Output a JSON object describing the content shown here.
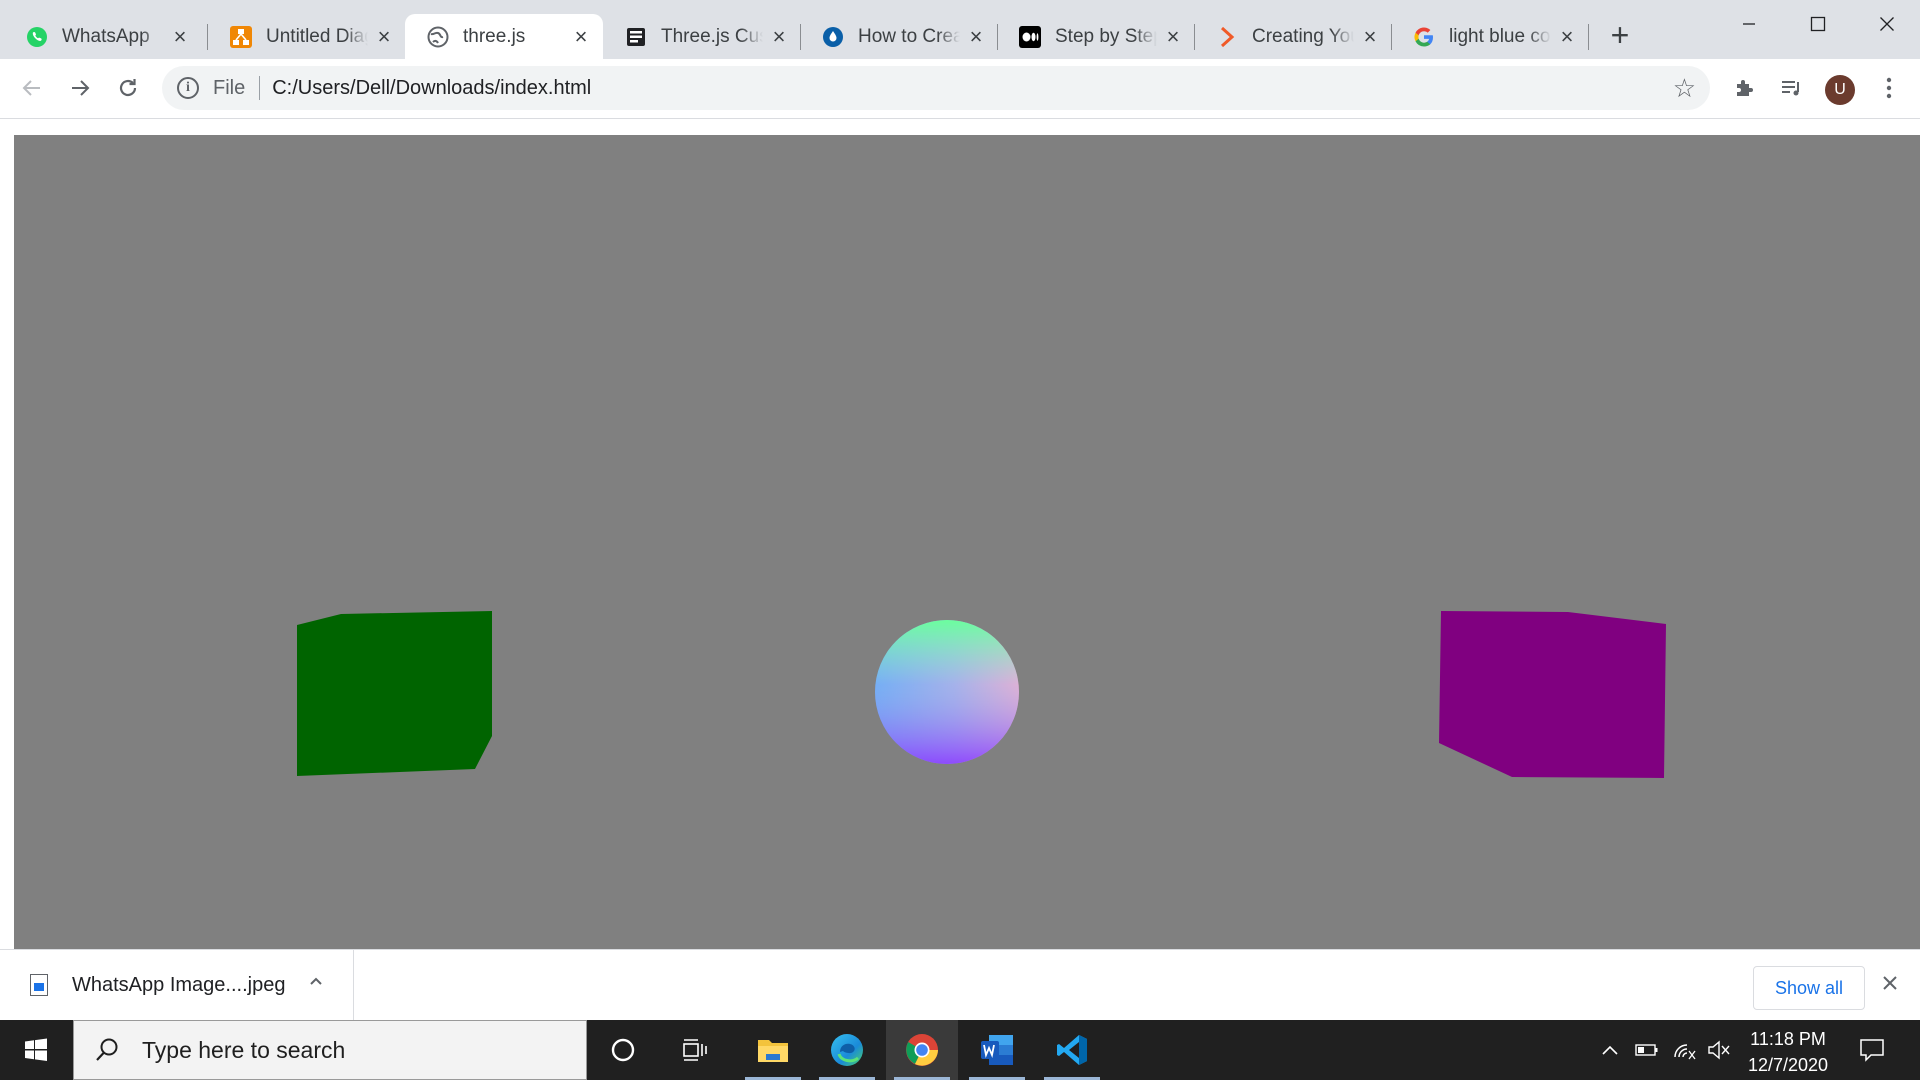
{
  "browser": {
    "tabs": [
      {
        "title": "WhatsApp",
        "favicon": "whatsapp-icon",
        "active": false
      },
      {
        "title": "Untitled Diagram",
        "favicon": "drawio-icon",
        "active": false
      },
      {
        "title": "three.js",
        "favicon": "globe-icon",
        "active": true
      },
      {
        "title": "Three.js Custom",
        "favicon": "document-icon",
        "active": false
      },
      {
        "title": "How to Create",
        "favicon": "drop-icon",
        "active": false
      },
      {
        "title": "Step by Step",
        "favicon": "medium-icon",
        "active": false
      },
      {
        "title": "Creating Your",
        "favicon": "chevron-logo-icon",
        "active": false
      },
      {
        "title": "light blue color",
        "favicon": "google-icon",
        "active": false
      }
    ],
    "address": {
      "scheme_label": "File",
      "url": "C:/Users/Dell/Downloads/index.html"
    },
    "profile_initial": "U"
  },
  "scene": {
    "background_color": "#808080",
    "objects": [
      {
        "name": "green cube",
        "color": "#006400"
      },
      {
        "name": "normal-material sphere",
        "color": "gradient"
      },
      {
        "name": "purple cube",
        "color": "#800080"
      }
    ]
  },
  "downloads": {
    "file_name": "WhatsApp Image....jpeg",
    "show_all_label": "Show all"
  },
  "taskbar": {
    "search_placeholder": "Type here to search",
    "time": "11:18 PM",
    "date": "12/7/2020"
  }
}
